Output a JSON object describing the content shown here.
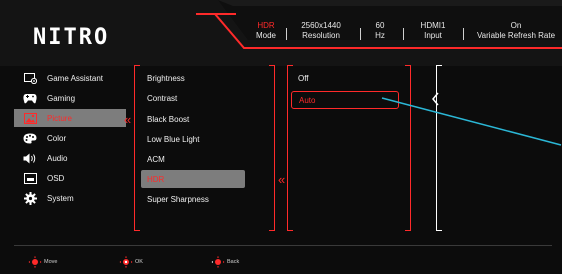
{
  "brand": {
    "logo": "NITRO"
  },
  "status_bar": [
    {
      "value": "HDR",
      "label": "Mode"
    },
    {
      "value": "2560x1440",
      "label": "Resolution"
    },
    {
      "value": "60",
      "label": "Hz"
    },
    {
      "value": "HDMI1",
      "label": "Input"
    },
    {
      "value": "On",
      "label": "Variable Refresh Rate"
    }
  ],
  "nav": {
    "items": [
      {
        "label": "Game Assistant",
        "icon": "game-assistant-icon"
      },
      {
        "label": "Gaming",
        "icon": "gamepad-icon"
      },
      {
        "label": "Picture",
        "icon": "picture-icon"
      },
      {
        "label": "Color",
        "icon": "palette-icon"
      },
      {
        "label": "Audio",
        "icon": "speaker-icon"
      },
      {
        "label": "OSD",
        "icon": "osd-icon"
      },
      {
        "label": "System",
        "icon": "gear-icon"
      }
    ],
    "selected": "Picture"
  },
  "submenu": {
    "items": [
      "Brightness",
      "Contrast",
      "Black Boost",
      "Low Blue Light",
      "ACM",
      "HDR",
      "Super Sharpness"
    ],
    "selected": "HDR"
  },
  "options": {
    "items": [
      "Off",
      "Auto"
    ],
    "selected": "Auto"
  },
  "footer": [
    {
      "label": "Move",
      "icon": "joystick-move-icon"
    },
    {
      "label": "OK",
      "icon": "joystick-ok-icon"
    },
    {
      "label": "Back",
      "icon": "joystick-back-icon"
    }
  ],
  "colors": {
    "accent": "#ff2a2a",
    "highlight": "#7d7d7d",
    "background": "#0c0c0c",
    "pointer_line": "#2bb7d6"
  }
}
